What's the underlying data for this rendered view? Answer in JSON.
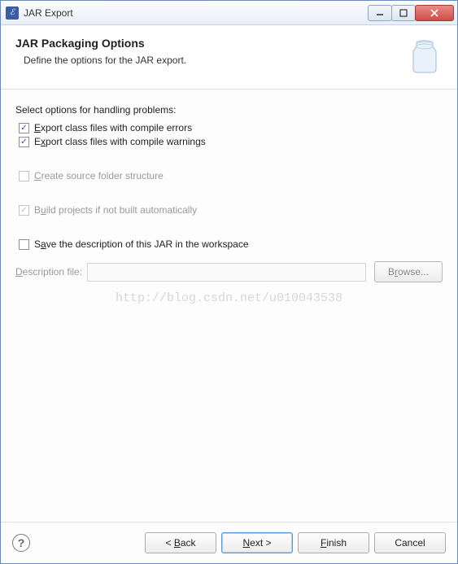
{
  "titlebar": {
    "title": "JAR Export"
  },
  "header": {
    "title": "JAR Packaging Options",
    "subtitle": "Define the options for the JAR export."
  },
  "options": {
    "section_label": "Select options for handling problems:",
    "export_errors": {
      "label": "Export class files with compile errors",
      "checked": true,
      "enabled": true
    },
    "export_warnings": {
      "label": "Export class files with compile warnings",
      "checked": true,
      "enabled": true
    },
    "create_source_folder": {
      "label": "Create source folder structure",
      "checked": false,
      "enabled": false
    },
    "build_projects": {
      "label": "Build projects if not built automatically",
      "checked": true,
      "enabled": false
    },
    "save_description": {
      "label": "Save the description of this JAR in the workspace",
      "checked": false,
      "enabled": true
    }
  },
  "description": {
    "label": "Description file:",
    "value": "",
    "browse_label": "Browse...",
    "enabled": false
  },
  "buttons": {
    "back": "< Back",
    "next": "Next >",
    "finish": "Finish",
    "cancel": "Cancel"
  },
  "watermark": "http://blog.csdn.net/u010043538"
}
